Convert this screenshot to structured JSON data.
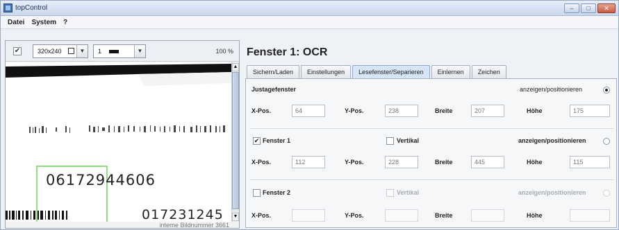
{
  "window": {
    "title": "topControl",
    "buttons": [
      "–",
      "□",
      "✕"
    ]
  },
  "menu": [
    "Datei",
    "System",
    "?"
  ],
  "toolbar": {
    "enabled_checked": true,
    "resolution": "320x240",
    "mode": "1",
    "zoom": "100 %"
  },
  "image": {
    "big_number": "06172944606",
    "small_number": "017231245",
    "status": "interne Bildnummer 3661"
  },
  "panel": {
    "heading": "Fenster 1: OCR",
    "tabs": [
      "Sichern/Laden",
      "Einstellungen",
      "Lesefenster/Separieren",
      "Einlernen",
      "Zeichen"
    ],
    "active_tab": "Lesefenster/Separieren"
  },
  "labels": {
    "xpos": "X-Pos.",
    "ypos": "Y-Pos.",
    "breite": "Breite",
    "hoehe": "Höhe"
  },
  "sections": {
    "justage": {
      "title": "Justagefenster",
      "show_label": "anzeigen/positionieren",
      "x": "64",
      "y": "238",
      "breite": "207",
      "hoehe": "175"
    },
    "fenster1": {
      "title": "Fenster 1",
      "checked": true,
      "vertikal": "Vertikal",
      "show_label": "anzeigen/positionieren",
      "x": "112",
      "y": "228",
      "breite": "445",
      "hoehe": "115"
    },
    "fenster2": {
      "title": "Fenster 2",
      "checked": false,
      "vertikal": "Vertikal",
      "show_label": "anzeigen/positionieren",
      "x": "",
      "y": "",
      "breite": "",
      "hoehe": ""
    }
  }
}
